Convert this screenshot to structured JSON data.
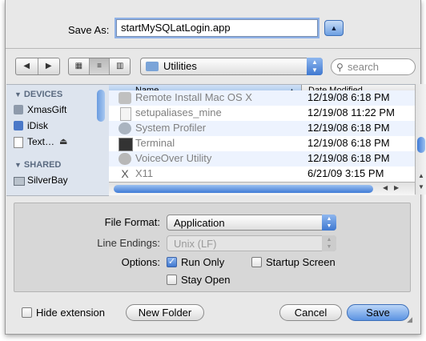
{
  "save": {
    "label": "Save As:",
    "filename": "startMySQLatLogin.app",
    "expand_icon": "triangle-up-icon"
  },
  "toolbar": {
    "back_icon": "◀",
    "forward_icon": "▶",
    "view_icons": [
      "▦",
      "≡",
      "▥"
    ],
    "location": "Utilities",
    "search_placeholder": "search"
  },
  "sidebar": {
    "sections": [
      {
        "title": "DEVICES",
        "items": [
          "XmasGift",
          "iDisk",
          "Text…"
        ]
      },
      {
        "title": "SHARED",
        "items": [
          "SilverBay"
        ]
      }
    ]
  },
  "columns": {
    "name": "Name",
    "date": "Date Modified"
  },
  "files": [
    {
      "name": "Remote Install Mac OS X",
      "date": "12/19/08 6:18 PM"
    },
    {
      "name": "setupaliases_mine",
      "date": "12/19/08 11:22 PM"
    },
    {
      "name": "System Profiler",
      "date": "12/19/08 6:18 PM"
    },
    {
      "name": "Terminal",
      "date": "12/19/08 6:18 PM"
    },
    {
      "name": "VoiceOver Utility",
      "date": "12/19/08 6:18 PM"
    },
    {
      "name": "X11",
      "date": "6/21/09 3:15 PM"
    }
  ],
  "options": {
    "file_format_label": "File Format:",
    "file_format_value": "Application",
    "line_endings_label": "Line Endings:",
    "line_endings_value": "Unix (LF)",
    "options_label": "Options:",
    "run_only": "Run Only",
    "startup_screen": "Startup Screen",
    "stay_open": "Stay Open",
    "run_only_checked": true,
    "startup_screen_checked": false,
    "stay_open_checked": false
  },
  "bottom": {
    "hide_extension": "Hide extension",
    "hide_extension_checked": false,
    "new_folder": "New Folder",
    "cancel": "Cancel",
    "save": "Save"
  }
}
